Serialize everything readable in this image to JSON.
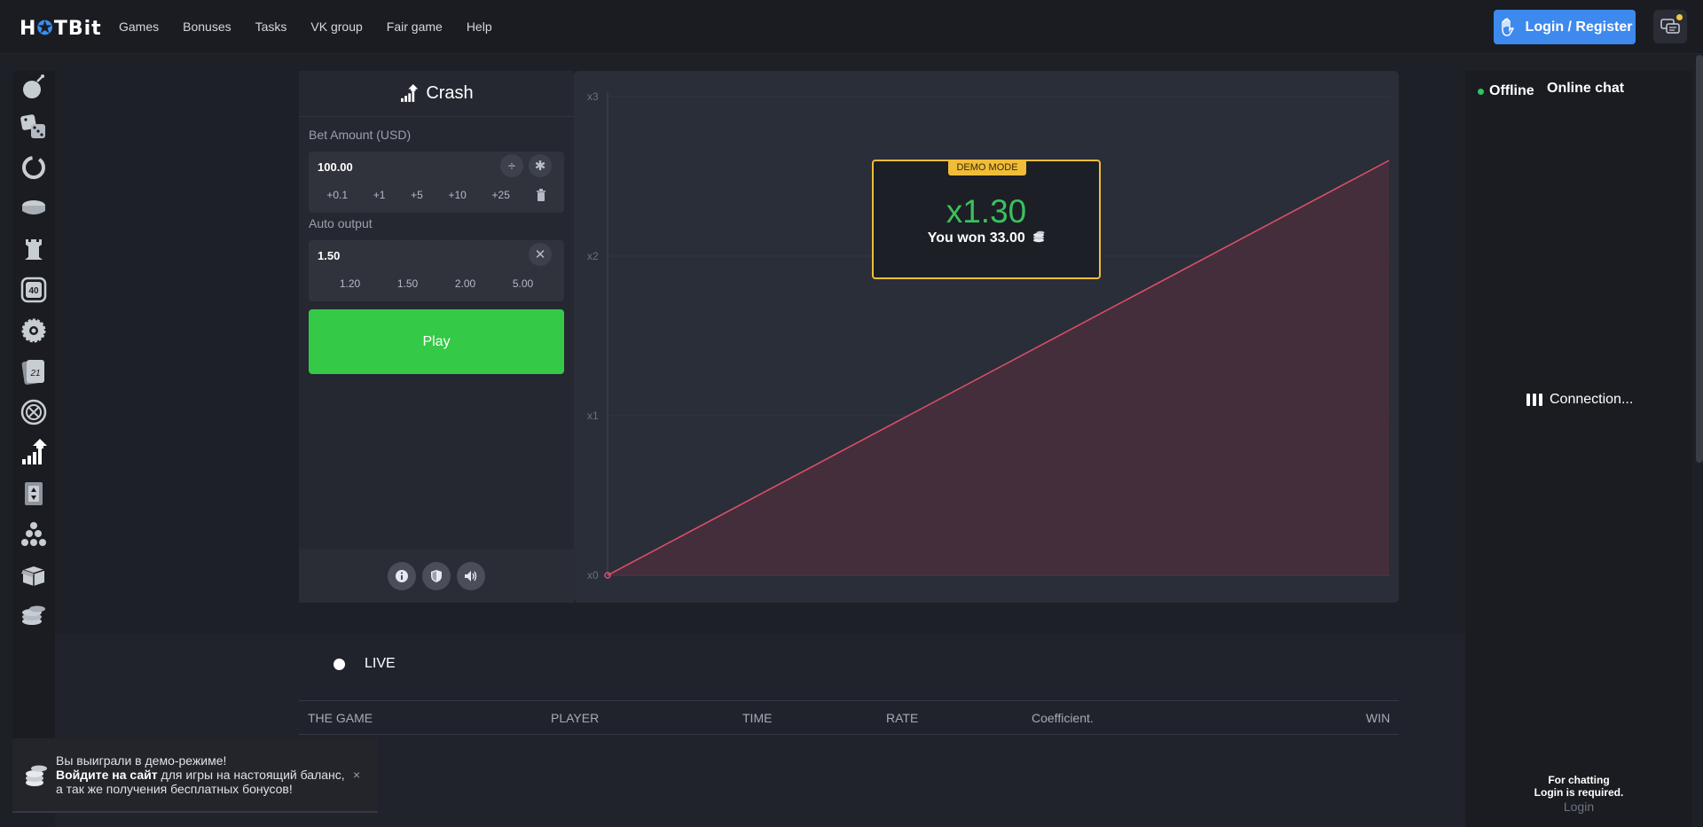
{
  "brand": {
    "logo_pre": "H",
    "logo_o": "✪",
    "logo_post": "TBit"
  },
  "nav": {
    "items": [
      "Games",
      "Bonuses",
      "Tasks",
      "VK group",
      "Fair game",
      "Help"
    ]
  },
  "header": {
    "login_label": "Login / Register"
  },
  "game": {
    "title": "Crash",
    "bet_label": "Bet Amount (USD)",
    "bet_value": "100.00",
    "divide_symbol": "÷",
    "multiply_symbol": "✱",
    "bet_chips": [
      "+0.1",
      "+1",
      "+5",
      "+10",
      "+25"
    ],
    "auto_label": "Auto output",
    "auto_value": "1.50",
    "clear_symbol": "✕",
    "auto_chips": [
      "1.20",
      "1.50",
      "2.00",
      "5.00"
    ],
    "play_label": "Play"
  },
  "graph": {
    "y_ticks": [
      "x3",
      "x2",
      "x1",
      "x0"
    ],
    "demo_tag": "DEMO MODE",
    "multiplier": "x1.30",
    "won_text": "You won 33.00"
  },
  "live": {
    "label": "LIVE",
    "columns": [
      "THE GAME",
      "PLAYER",
      "TIME",
      "RATE",
      "Coefficient.",
      "WIN"
    ]
  },
  "chat": {
    "status": "Offline",
    "title": "Online chat",
    "connection": "Connection...",
    "footer_line1": "For chatting",
    "footer_line2": "Login is required.",
    "login_link": "Login"
  },
  "toast": {
    "line1": "Вы выиграли в демо-режиме!",
    "line2_bold": "Войдите на сайт",
    "line2_rest": " для игры на настоящий баланс,",
    "line3": "а так же получения бесплатных бонусов!",
    "close": "×"
  },
  "colors": {
    "accent": "#3d89ee",
    "play": "#34c946",
    "win": "#3ac15d",
    "demo": "#f0bd3a",
    "line": "#e0506a"
  }
}
